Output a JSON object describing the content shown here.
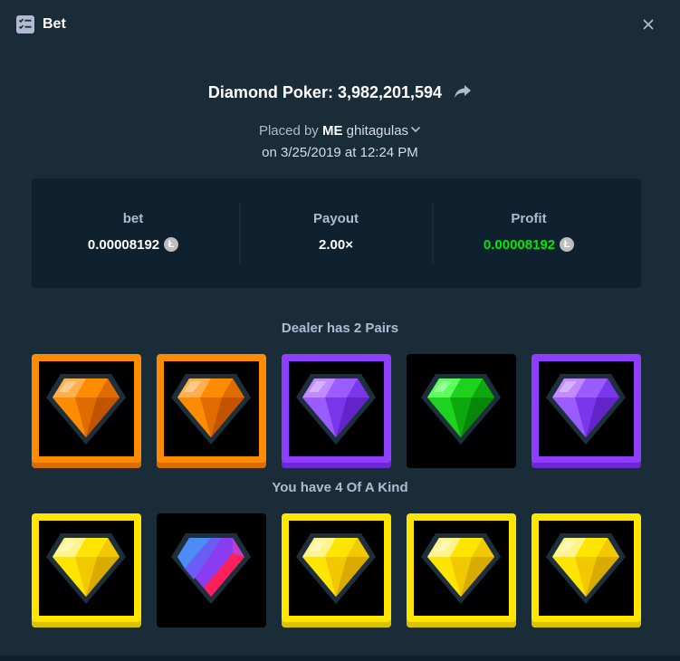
{
  "header": {
    "title": "Bet",
    "title_icon": "checklist-icon",
    "close_icon": "close-icon"
  },
  "bet_info": {
    "game_title": "Diamond Poker: 3,982,201,594",
    "share_icon": "share-arrow-icon",
    "placed_by_prefix": "Placed by",
    "placed_by_tag": "ME",
    "username": "ghitagulas",
    "date_line": "on 3/25/2019 at 12:24 PM"
  },
  "stats": [
    {
      "label": "bet",
      "value": "0.00008192",
      "currency_icon": "litecoin-icon",
      "color": "#ffffff"
    },
    {
      "label": "Payout",
      "value": "2.00×",
      "color": "#ffffff"
    },
    {
      "label": "Profit",
      "value": "0.00008192",
      "currency_icon": "litecoin-icon",
      "color": "#00e701"
    }
  ],
  "dealer": {
    "label": "Dealer has 2 Pairs",
    "cards": [
      {
        "gem": "orange",
        "framed": true
      },
      {
        "gem": "orange",
        "framed": true
      },
      {
        "gem": "purple",
        "framed": true
      },
      {
        "gem": "green",
        "framed": false
      },
      {
        "gem": "purple",
        "framed": true
      }
    ]
  },
  "player": {
    "label": "You have 4 Of A Kind",
    "cards": [
      {
        "gem": "yellow",
        "framed": true
      },
      {
        "gem": "multicolor",
        "framed": false
      },
      {
        "gem": "yellow",
        "framed": true
      },
      {
        "gem": "yellow",
        "framed": true
      },
      {
        "gem": "yellow",
        "framed": true
      }
    ]
  },
  "colors": {
    "background": "#1a2c38",
    "panel": "#0f212e",
    "profit": "#00e701",
    "orange": "#ff8c00",
    "purple": "#8f3eff",
    "yellow": "#ffe500",
    "green": "#1fd21f"
  }
}
